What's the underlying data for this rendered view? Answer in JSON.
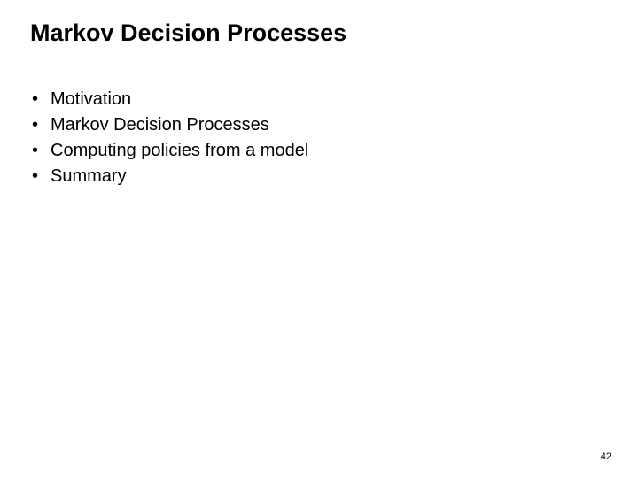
{
  "title": "Markov Decision Processes",
  "bullets": {
    "item0": "Motivation",
    "item1": "Markov Decision Processes",
    "item2": "Computing policies from a model",
    "item3": "Summary"
  },
  "page_number": "42"
}
